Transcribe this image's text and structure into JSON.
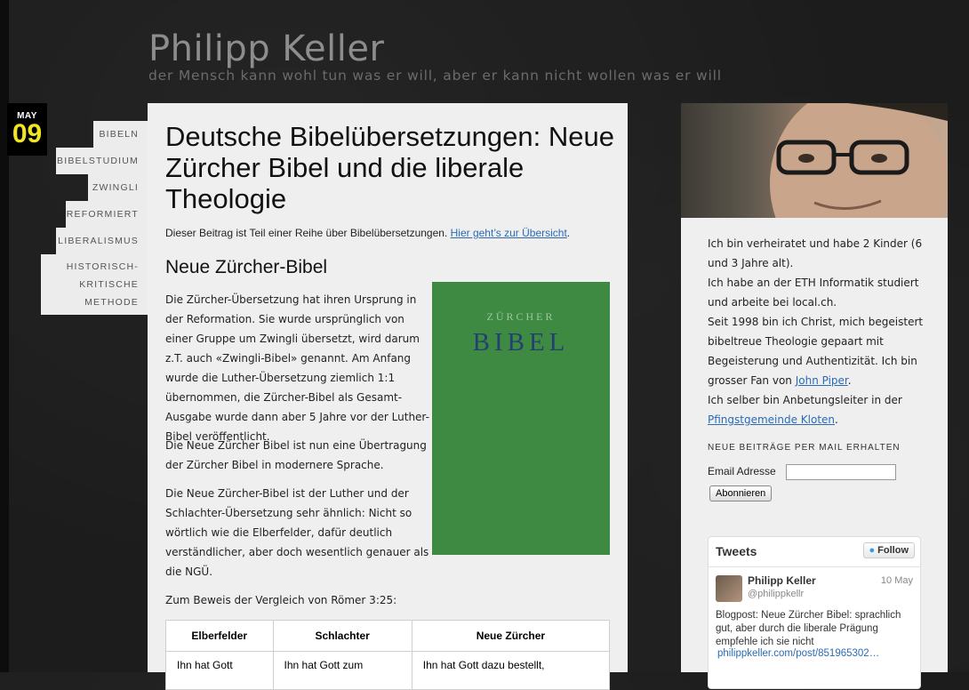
{
  "site": {
    "title": "Philipp Keller",
    "tagline": "der Mensch kann wohl tun was er will, aber er kann nicht wollen was er will"
  },
  "date": {
    "month": "MAY",
    "day": "09"
  },
  "tags": [
    "BIBELN",
    "BIBELSTUDIUM",
    "ZWINGLI",
    "REFORMIERT",
    "LIBERALISMUS",
    "HISTORISCH-",
    "KRITISCHE",
    "METHODE"
  ],
  "post": {
    "title": "Deutsche Bibelübersetzungen: Neue Zürcher Bibel und die liberale Theologie",
    "intro_text": "Dieser Beitrag ist Teil einer Reihe über Bibelübersetzungen. ",
    "intro_link": "Hier geht’s zur Übersicht",
    "intro_end": ".",
    "section_heading": "Neue Zürcher-Bibel",
    "p1": "Die Zürcher-Übersetzung hat ihren Ursprung in der Reformation. Sie wurde ursprünglich von einer Gruppe um Zwingli übersetzt, wird darum z.T. auch «Zwingli-Bibel» genannt. Am Anfang wurde die Luther-Übersetzung ziemlich 1:1 übernommen, die Zürcher-Bibel als Gesamt-Ausgabe wurde dann aber 5 Jahre vor der Luther-Bibel veröffentlicht.",
    "p2": "Die Neue Zürcher Bibel ist nun eine Übertragung der Zürcher Bibel in modernere Sprache.",
    "p3": "Die Neue Zürcher-Bibel ist der Luther und der Schlachter-Übersetzung sehr ähnlich: Nicht so wörtlich wie die Elberfelder, dafür deutlich verständlicher, aber doch wesentlich genauer als die NGÜ.",
    "p4": "Zum Beweis der Vergleich von Römer 3:25:",
    "book": {
      "top": "ZÜRCHER",
      "main": "BIBEL"
    },
    "table": {
      "headers": [
        "Elberfelder",
        "Schlachter",
        "Neue Zürcher"
      ],
      "row1": [
        "Ihn hat Gott",
        "Ihn hat Gott zum",
        "Ihn hat Gott dazu bestellt,"
      ]
    }
  },
  "sidebar": {
    "bio": {
      "l1": "Ich bin verheiratet und habe 2 Kinder (6 und 3 Jahre alt).",
      "l2": "Ich habe an der ETH Informatik studiert und arbeite bei local.ch.",
      "l3a": "Seit 1998 bin ich Christ, mich begeistert bibeltreue Theologie gepaart mit Begeisterung und Authentizität. Ich bin grosser Fan von ",
      "l3link": "John Piper",
      "l3b": ".",
      "l4a": "Ich selber bin Anbetungsleiter in der ",
      "l4link": "Pfingstgemeinde Kloten",
      "l4b": "."
    },
    "mail": {
      "heading": "NEUE BEITRÄGE PER MAIL ERHALTEN",
      "label": "Email Adresse",
      "button": "Abonnieren"
    },
    "tweets": {
      "heading": "Tweets",
      "follow": "Follow",
      "name": "Philipp Keller",
      "handle": "@philippkellr",
      "date": "10 May",
      "text": "Blogpost: Neue Zürcher Bibel: sprachlich gut, aber durch die liberale Prägung empfehle ich sie nicht",
      "link": "philippkeller.com/post/851965302…"
    }
  }
}
